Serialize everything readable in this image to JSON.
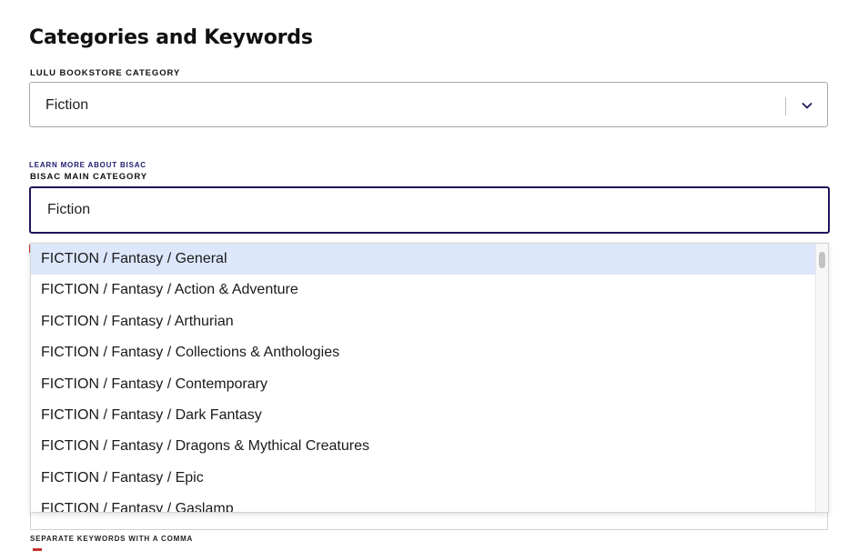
{
  "section": {
    "title": "Categories and Keywords"
  },
  "bookstore_category": {
    "label": "LULU BOOKSTORE CATEGORY",
    "selected": "Fiction"
  },
  "bisac": {
    "learn_more": "LEARN MORE ABOUT BISAC",
    "label": "BISAC MAIN CATEGORY",
    "value": "Fiction",
    "options": [
      "FICTION / Fantasy / General",
      "FICTION / Fantasy / Action & Adventure",
      "FICTION / Fantasy / Arthurian",
      "FICTION / Fantasy / Collections & Anthologies",
      "FICTION / Fantasy / Contemporary",
      "FICTION / Fantasy / Dark Fantasy",
      "FICTION / Fantasy / Dragons & Mythical Creatures",
      "FICTION / Fantasy / Epic",
      "FICTION / Fantasy / Gaslamp"
    ],
    "highlighted_option": "FICTION / Fantasy / General"
  },
  "keywords": {
    "hint": "SEPARATE KEYWORDS WITH A COMMA"
  },
  "colors": {
    "focus_border": "#1c1659",
    "highlight_bg": "#dde7fb",
    "link": "#1e1a6e",
    "error": "#c9302c"
  }
}
